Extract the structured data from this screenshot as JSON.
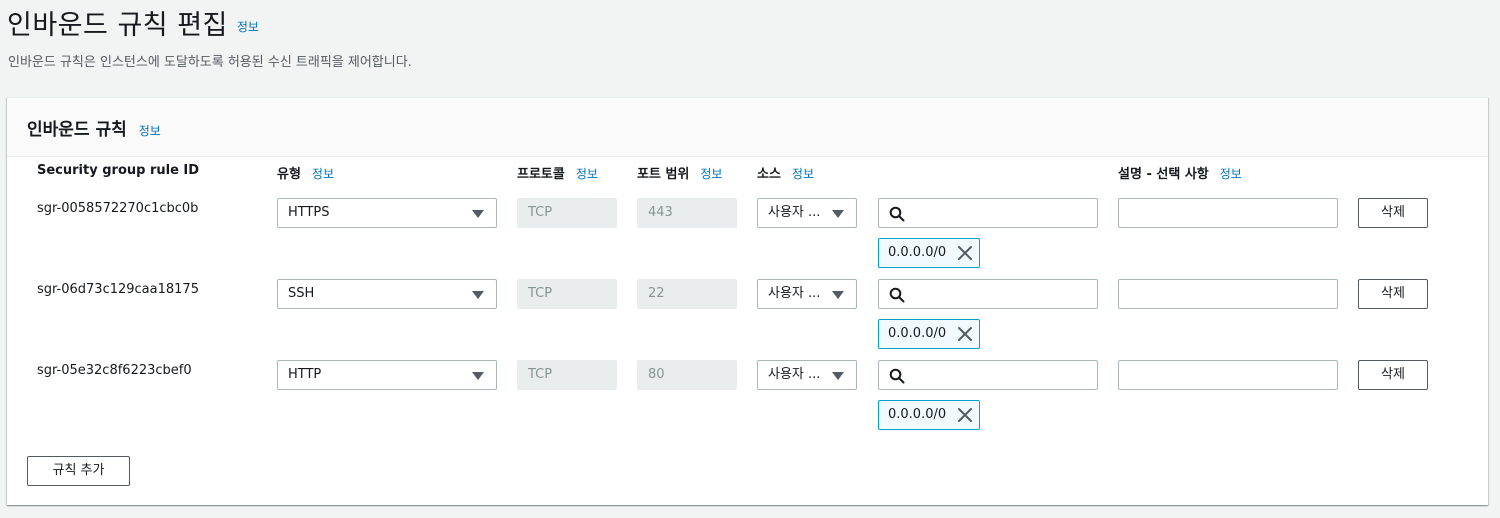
{
  "page": {
    "title": "인바운드 규칙 편집",
    "title_info": "정보",
    "description": "인바운드 규칙은 인스턴스에 도달하도록 허용된 수신 트래픽을 제어합니다."
  },
  "panel": {
    "title": "인바운드 규칙",
    "info": "정보"
  },
  "columns": {
    "rule_id": "Security group rule ID",
    "type": "유형",
    "protocol": "프로토콜",
    "port_range": "포트 범위",
    "source": "소스",
    "description": "설명 - 선택 사항",
    "info": "정보"
  },
  "rules": [
    {
      "id": "sgr-0058572270c1cbc0b",
      "type": "HTTPS",
      "protocol": "TCP",
      "port": "443",
      "source_type": "사용자 ...",
      "search_value": "",
      "cidr": "0.0.0.0/0",
      "description": "",
      "delete_label": "삭제"
    },
    {
      "id": "sgr-06d73c129caa18175",
      "type": "SSH",
      "protocol": "TCP",
      "port": "22",
      "source_type": "사용자 ...",
      "search_value": "",
      "cidr": "0.0.0.0/0",
      "description": "",
      "delete_label": "삭제"
    },
    {
      "id": "sgr-05e32c8f6223cbef0",
      "type": "HTTP",
      "protocol": "TCP",
      "port": "80",
      "source_type": "사용자 ...",
      "search_value": "",
      "cidr": "0.0.0.0/0",
      "description": "",
      "delete_label": "삭제"
    }
  ],
  "add_rule_label": "규칙 추가",
  "icons": {
    "search": "search-icon",
    "remove": "close-icon",
    "dropdown": "caret-down-icon"
  },
  "colors": {
    "link": "#0073bb",
    "token_border": "#00a1c9",
    "token_bg": "#f1faff"
  }
}
